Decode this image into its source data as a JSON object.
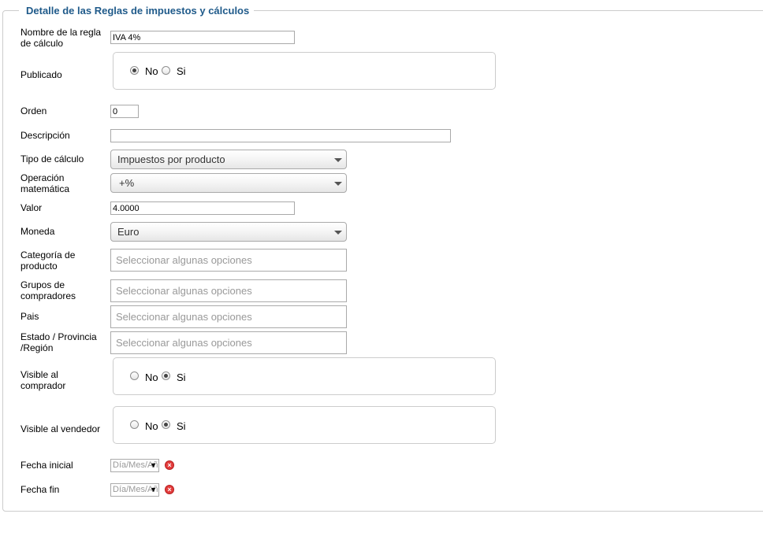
{
  "legend": "Detalle de las Reglas de impuestos y cálculos",
  "fields": {
    "nombre": {
      "label_line1": "Nombre de la regla",
      "label_line2": "de cálculo",
      "value": "IVA 4%"
    },
    "publicado": {
      "label": "Publicado",
      "option_no": "No",
      "option_si": "Si",
      "selected": "No"
    },
    "orden": {
      "label": "Orden",
      "value": "0"
    },
    "descripcion": {
      "label": "Descripción",
      "value": ""
    },
    "tipo_calculo": {
      "label": "Tipo de cálculo",
      "value": "Impuestos por producto"
    },
    "operacion": {
      "label_line1": "Operación",
      "label_line2": "matemática",
      "value": "+%"
    },
    "valor": {
      "label": "Valor",
      "value": "4.0000"
    },
    "moneda": {
      "label": "Moneda",
      "value": "Euro"
    },
    "categoria": {
      "label_line1": "Categoría de",
      "label_line2": "producto",
      "placeholder": "Seleccionar algunas opciones"
    },
    "grupos": {
      "label_line1": "Grupos de",
      "label_line2": "compradores",
      "placeholder": "Seleccionar algunas opciones"
    },
    "pais": {
      "label": "Pais",
      "placeholder": "Seleccionar algunas opciones"
    },
    "estado": {
      "label_line1": "Estado / Provincia",
      "label_line2": "/Región",
      "placeholder": "Seleccionar algunas opciones"
    },
    "visible_comprador": {
      "label_line1": "Visible al",
      "label_line2": "comprador",
      "option_no": "No",
      "option_si": "Si",
      "selected": "Si"
    },
    "visible_vendedor": {
      "label": "Visible al vendedor",
      "option_no": "No",
      "option_si": "Si",
      "selected": "Si"
    },
    "fecha_inicial": {
      "label": "Fecha inicial",
      "placeholder": "Día/Mes/Año"
    },
    "fecha_fin": {
      "label": "Fecha fin",
      "placeholder": "Día/Mes/Año"
    }
  },
  "icons": {
    "dropdown": "chevron-down-icon",
    "clear": "clear-x-icon"
  },
  "colors": {
    "legend": "#1f5a8a",
    "clear_button": "#e33d3d"
  }
}
